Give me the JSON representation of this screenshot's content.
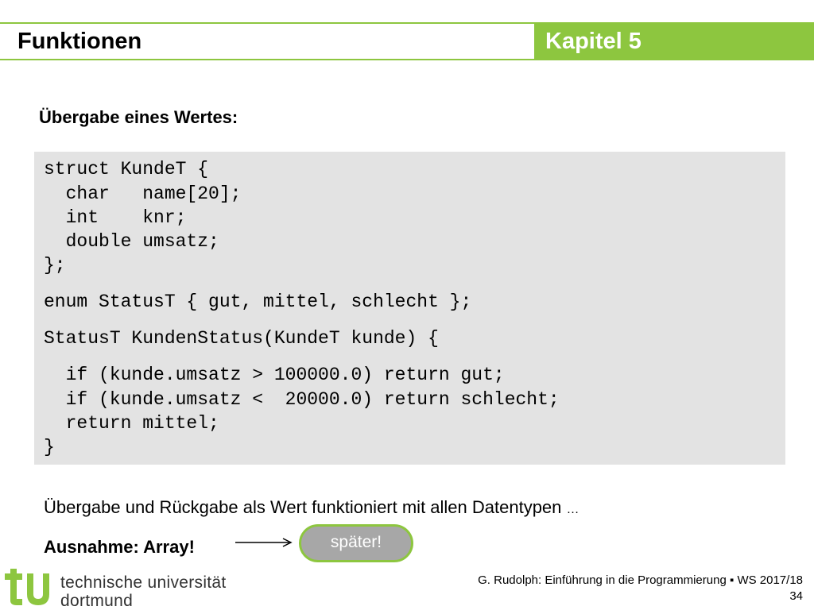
{
  "header": {
    "title": "Funktionen",
    "chapter": "Kapitel 5"
  },
  "subtitle": "Übergabe eines Wertes:",
  "code": {
    "lines": [
      "struct KundeT {",
      "  char   name[20];",
      "  int    knr;",
      "  double umsatz;",
      "};",
      "enum StatusT { gut, mittel, schlecht };",
      "StatusT KundenStatus(KundeT kunde) {",
      "  if (kunde.umsatz > 100000.0) return gut;",
      "  if (kunde.umsatz <  20000.0) return schlecht;",
      "  return mittel;",
      "}"
    ]
  },
  "note": {
    "text": "Übergabe und Rückgabe als Wert funktioniert mit allen Datentypen ",
    "ellipsis": "…"
  },
  "exception": "Ausnahme: Array!",
  "callout": "später!",
  "footer": {
    "university_line1": "technische universität",
    "university_line2": "dortmund",
    "credit": "G. Rudolph: Einführung in die Programmierung ▪ WS 2017/18",
    "page": "34"
  },
  "colors": {
    "accent": "#8dc63f",
    "code_background": "#e3e3e3",
    "callout_fill": "#a7a7a7"
  },
  "icons": {
    "logo": "tu-logo-icon",
    "arrow": "arrow-right-icon"
  }
}
